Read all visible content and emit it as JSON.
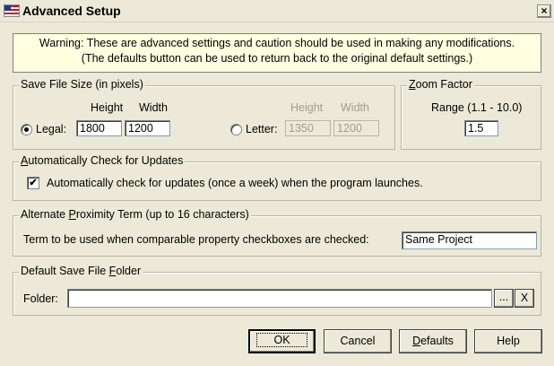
{
  "window": {
    "title": "Advanced Setup",
    "close_label": "×"
  },
  "warning": {
    "line1": "Warning:  These are advanced settings and caution should be used in making any modifications.",
    "line2": "(The defaults button can be used to return back to the original default settings.)"
  },
  "save_size": {
    "group_label": "Save File Size (in pixels)",
    "height_header": "Height",
    "width_header": "Width",
    "legal": {
      "label": "Legal:",
      "selected": true,
      "height": "1800",
      "width": "1200"
    },
    "letter": {
      "label": "Letter:",
      "selected": false,
      "height": "1350",
      "width": "1200"
    }
  },
  "zoom": {
    "group_label_prefix": "",
    "group_label_u": "Z",
    "group_label_rest": "oom Factor",
    "range_label": "Range (1.1 - 10.0)",
    "value": "1.5"
  },
  "updates": {
    "group_label_u": "A",
    "group_label_rest": "utomatically Check for Updates",
    "checkbox_label": "Automatically check for updates (once a week) when the program launches.",
    "checked": true,
    "check_glyph": "✔"
  },
  "proximity": {
    "group_label_pre": "Alternate ",
    "group_label_u": "P",
    "group_label_rest": "roximity Term (up to 16 characters)",
    "prompt": "Term to be used when comparable property checkboxes are checked:",
    "value": "Same Project"
  },
  "folder": {
    "group_label_pre": "Default Save File ",
    "group_label_u": "F",
    "group_label_rest": "older",
    "label": "Folder:",
    "value": "",
    "browse_label": "...",
    "clear_label": "X"
  },
  "buttons": {
    "ok": "OK",
    "cancel": "Cancel",
    "defaults_u": "D",
    "defaults_rest": "efaults",
    "help": "Help"
  }
}
